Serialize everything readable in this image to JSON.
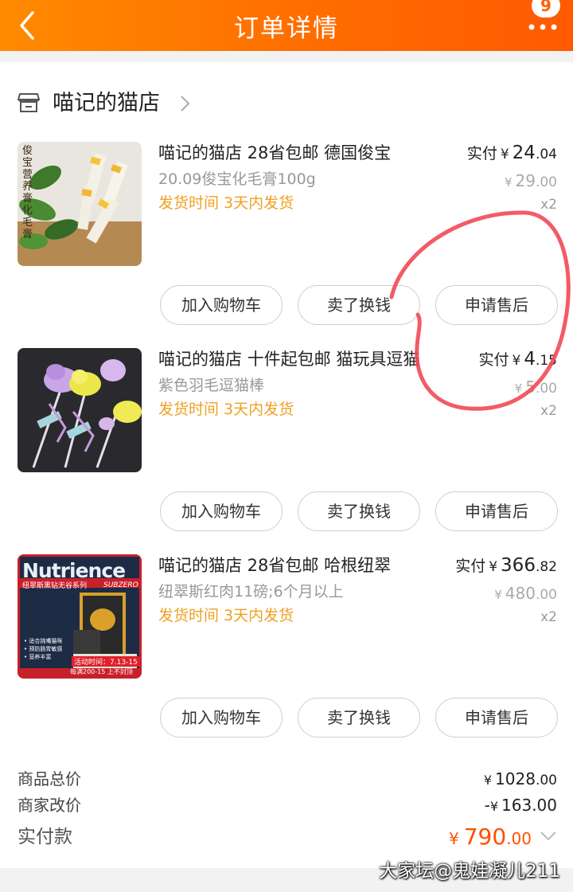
{
  "header": {
    "title": "订单详情",
    "badge": "9",
    "back_icon": "chevron-left-icon",
    "more_icon": "ellipsis-icon"
  },
  "shop": {
    "name": "喵记的猫店",
    "icon": "store-icon"
  },
  "items": [
    {
      "title": "喵记的猫店 28省包邮 德国俊宝",
      "spec": "20.09俊宝化毛膏100g",
      "shipping": "发货时间 3天内发货",
      "paid_label": "实付",
      "currency": "¥",
      "paid_int": "24",
      "paid_dec": ".04",
      "orig_int": "29",
      "orig_dec": ".00",
      "qty": "x2",
      "thumb_text": "俊宝营养膏 化毛膏",
      "buttons": [
        "加入购物车",
        "卖了换钱",
        "申请售后"
      ]
    },
    {
      "title": "喵记的猫店 十件起包邮 猫玩具逗猫",
      "spec": "紫色羽毛逗猫棒",
      "shipping": "发货时间 3天内发货",
      "paid_label": "实付",
      "currency": "¥",
      "paid_int": "4",
      "paid_dec": ".15",
      "orig_int": "5",
      "orig_dec": ".00",
      "qty": "x2",
      "thumb_text": "",
      "buttons": [
        "加入购物车",
        "卖了换钱",
        "申请售后"
      ]
    },
    {
      "title": "喵记的猫店 28省包邮 哈根纽翠",
      "spec": "纽翠斯红肉11磅;6个月以上",
      "shipping": "发货时间 3天内发货",
      "paid_label": "实付",
      "currency": "¥",
      "paid_int": "366",
      "paid_dec": ".82",
      "orig_int": "480",
      "orig_dec": ".00",
      "qty": "x2",
      "thumb_brand": "Nutrience",
      "thumb_sub": "SUBZERO",
      "thumb_series": "纽翠斯黑钻无谷系列",
      "thumb_bullets": [
        "• 适合挑嘴猫咪",
        "• 预防肠胃敏感",
        "• 营养丰富"
      ],
      "thumb_promo": "活动时间：7.13-15",
      "thumb_promo2": "每满200-15 上不封顶",
      "buttons": [
        "加入购物车",
        "卖了换钱",
        "申请售后"
      ]
    }
  ],
  "summary": {
    "rows": [
      {
        "label": "商品总价",
        "currency": "¥",
        "int": "1028",
        "dec": ".00"
      },
      {
        "label": "商家改价",
        "sign": "-",
        "currency": "¥",
        "int": "163",
        "dec": ".00"
      }
    ],
    "total_label": "实付款",
    "total_currency": "¥",
    "total_int": "790",
    "total_dec": ".00"
  },
  "colors": {
    "accent": "#ff6a00",
    "price_highlight": "#ff5000",
    "shipping_text": "#f0a020",
    "annotation": "#f04a55"
  },
  "watermark": "大家坛@鬼娃凝儿211"
}
